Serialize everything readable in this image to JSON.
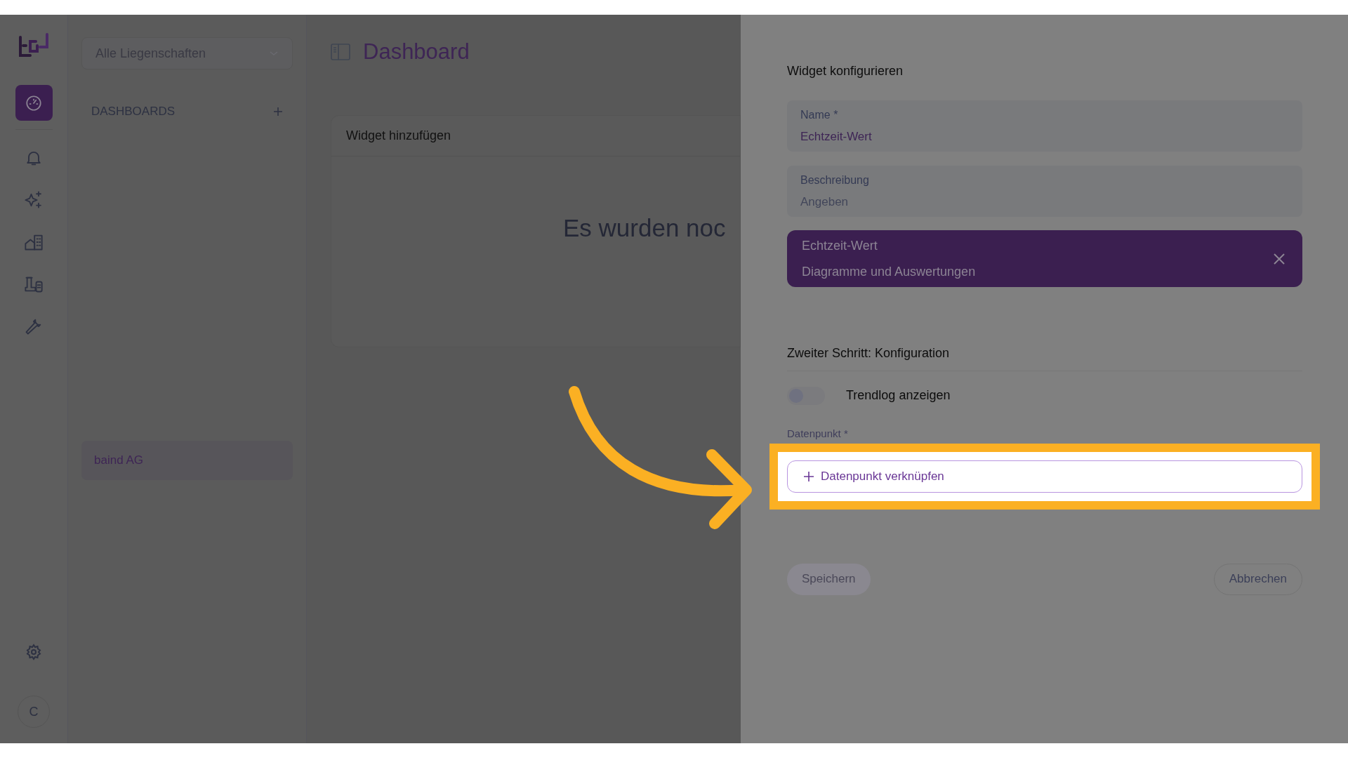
{
  "rail": {
    "items": [
      {
        "kind": "dashboard",
        "selected": true
      },
      {
        "kind": "bell",
        "selected": false
      },
      {
        "kind": "sparkles",
        "selected": false
      },
      {
        "kind": "buildings",
        "selected": false
      },
      {
        "kind": "machine",
        "selected": false
      },
      {
        "kind": "wrench",
        "selected": false
      }
    ],
    "avatar": "C"
  },
  "sidebar": {
    "property_select": {
      "placeholder": "Alle Liegenschaften"
    },
    "section": "DASHBOARDS",
    "items": [
      {
        "label": "baind AG",
        "selected": true
      }
    ]
  },
  "main": {
    "title": "Dashboard",
    "card": {
      "title": "Widget hinzufügen",
      "empty_text": "Es wurden noc"
    }
  },
  "panel": {
    "title": "Widget konfigurieren",
    "fields": [
      {
        "label": "Name *",
        "value": "Echtzeit-Wert"
      },
      {
        "label": "Beschreibung",
        "placeholder": "Angeben"
      }
    ],
    "widget": {
      "title": "Echtzeit-Wert",
      "subtitle": "Diagramme und Auswertungen"
    },
    "section": "Zweiter Schritt: Konfiguration",
    "toggle": {
      "label": "Trendlog anzeigen",
      "on": false
    },
    "datapoint": {
      "label": "Datenpunkt *",
      "button": "Datenpunkt verknüpfen"
    },
    "save": {
      "label": "Speichern",
      "disabled": true
    },
    "cancel": {
      "label": "Abbrechen"
    }
  }
}
